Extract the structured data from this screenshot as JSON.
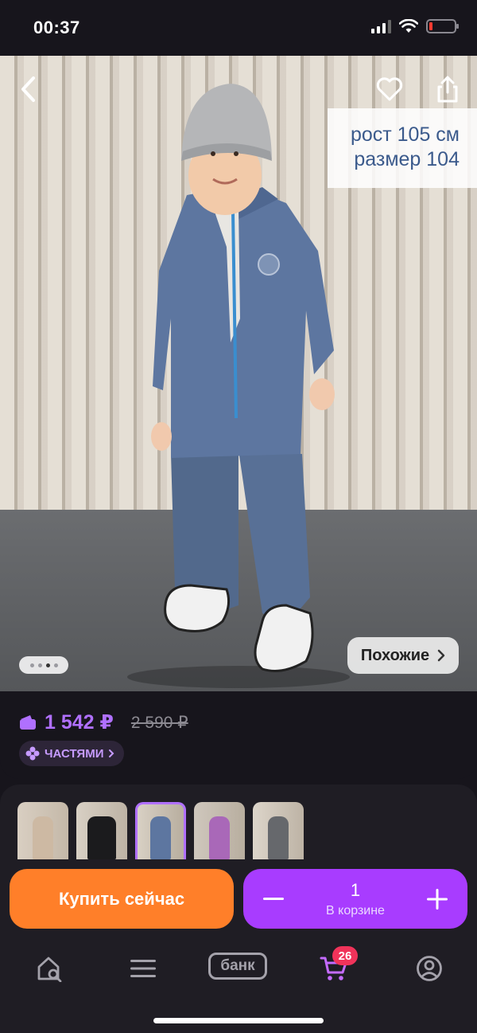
{
  "status_bar": {
    "time": "00:37"
  },
  "product_photo": {
    "size_tag": {
      "height_line": "рост 105 см",
      "size_line": "размер 104"
    },
    "similar_label": "Похожие"
  },
  "price": {
    "current": "1 542 ₽",
    "old": "2 590 ₽",
    "installments_label": "ЧАСТЯМИ"
  },
  "variants": [
    {
      "name": "beige"
    },
    {
      "name": "black"
    },
    {
      "name": "blue-grey",
      "selected": true
    },
    {
      "name": "purple"
    },
    {
      "name": "grey"
    }
  ],
  "actions": {
    "buy_now": "Купить сейчас",
    "cart_quantity": "1",
    "cart_label": "В корзине"
  },
  "tabbar": {
    "bank_label": "банк",
    "cart_badge": "26"
  },
  "colors": {
    "accent_purple": "#a83cff",
    "buy_orange": "#ff7f29",
    "badge_red": "#f0335a",
    "price_purple": "#b070ff"
  }
}
